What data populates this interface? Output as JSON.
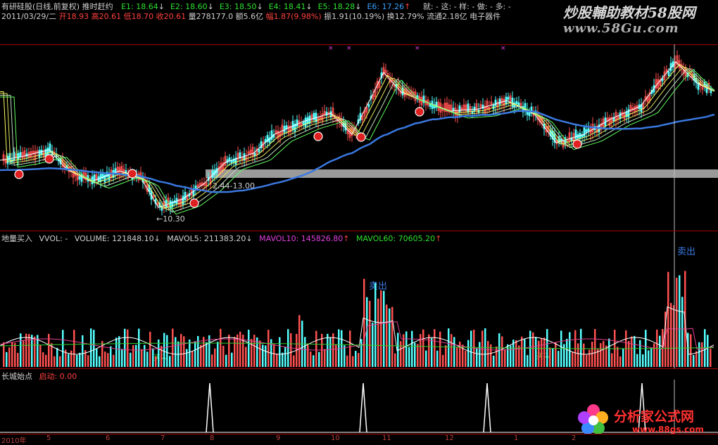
{
  "header": {
    "stock": "有研硅股(日线,前复权)",
    "indicator": "推时赶约",
    "e_items": [
      {
        "label": "E1: 18.64",
        "arrow": "↓",
        "color": "#30e030"
      },
      {
        "label": "E2: 18.60",
        "arrow": "↓",
        "color": "#30e030"
      },
      {
        "label": "E3: 18.50",
        "arrow": "↓",
        "color": "#30e030"
      },
      {
        "label": "E4: 18.41",
        "arrow": "↓",
        "color": "#30e030"
      },
      {
        "label": "E5: 18.28",
        "arrow": "↓",
        "color": "#30e030"
      },
      {
        "label": "E6: 17.26",
        "arrow": "↑",
        "color": "#3aa0ff"
      }
    ],
    "extra": "就: - 这: - 样: - 做: - 多: -",
    "date": "2011/03/29/二",
    "open": "开18.93",
    "high": "高20.61",
    "low": "低18.70",
    "close": "收20.61",
    "volume": "量278177.0",
    "amount": "额5.6亿",
    "change": "幅1.87(9.98%)",
    "amplitude": "振1.91(10.19%)",
    "turnover": "换12.79%",
    "float_cap": "流通2.18亿",
    "sector": "电子器件"
  },
  "watermark": {
    "top_title": "炒股輔助教材58股网",
    "top_url": "www.58Gu.com",
    "bottom_title": "分析家公式网",
    "bottom_url": "www.88gs.com"
  },
  "price_panel": {
    "annotation_mid": "2.44-13.00",
    "annotation_low": "←10.30"
  },
  "volume_panel": {
    "name": "地量买入",
    "vvol": "VVOL: -",
    "volume": "VOLUME: 121848.10",
    "volume_arrow": "↓",
    "mavol5": "MAVOL5: 211383.20",
    "mavol5_arrow": "↓",
    "mavol10": "MAVOL10: 145826.80",
    "mavol10_arrow": "↑",
    "mavol60": "MAVOL60: 70605.20",
    "mavol60_arrow": "↑",
    "sell_label_1": "卖出",
    "sell_label_2": "卖出",
    "buy_label_1": "买入",
    "buy_label_2": "买入"
  },
  "signal_panel": {
    "name": "长城始点",
    "start_label": "启动: 0.00"
  },
  "axis": {
    "year": "2010年",
    "months": [
      "5",
      "6",
      "7",
      "8",
      "9",
      "10",
      "11",
      "12",
      "1",
      "2"
    ]
  },
  "colors": {
    "background": "#000000",
    "grid": "#a00000",
    "up_bar": "#ff5050",
    "down_bar": "#54ffff",
    "ma_blue": "#3a78e0",
    "highlight": "#9a9a9a"
  }
}
